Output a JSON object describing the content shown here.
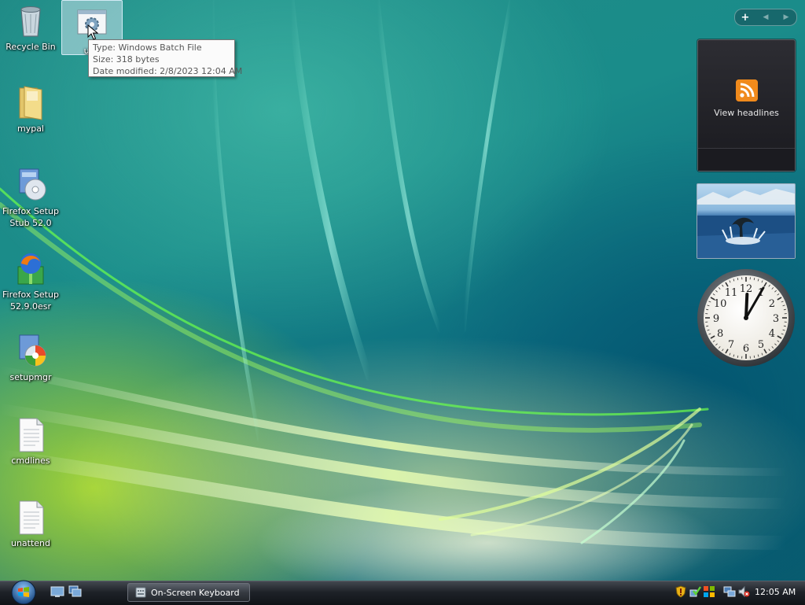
{
  "desktop": {
    "icons": [
      {
        "name": "recycle-bin",
        "label": "Recycle Bin"
      },
      {
        "name": "unattend-batch",
        "label": "una"
      },
      {
        "name": "mypal-folder",
        "label": "mypal"
      },
      {
        "name": "firefox-setup-stub",
        "label_line1": "Firefox Setup",
        "label_line2": "Stub 52.0"
      },
      {
        "name": "firefox-setup-esr",
        "label_line1": "Firefox Setup",
        "label_line2": "52.9.0esr"
      },
      {
        "name": "setupmgr",
        "label": "setupmgr"
      },
      {
        "name": "cmdlines",
        "label": "cmdlines"
      },
      {
        "name": "unattend",
        "label": "unattend"
      }
    ],
    "tooltip": {
      "type": "Type: Windows Batch File",
      "size": "Size: 318 bytes",
      "modified": "Date modified: 2/8/2023 12:04 AM"
    }
  },
  "sidebar": {
    "add_symbol": "+",
    "prev_symbol": "◀",
    "next_symbol": "▶",
    "feed_label": "View headlines",
    "clock": {
      "hour": 12,
      "minute": 5,
      "numerals": [
        "12",
        "1",
        "2",
        "3",
        "4",
        "5",
        "6",
        "7",
        "8",
        "9",
        "10",
        "11"
      ]
    }
  },
  "taskbar": {
    "task_label": "On-Screen Keyboard",
    "time": "12:05 AM"
  },
  "colors": {
    "tooltip_text": "#575757",
    "rss_orange": "#f08a1c",
    "taskbar_dark": "#1e2228"
  }
}
